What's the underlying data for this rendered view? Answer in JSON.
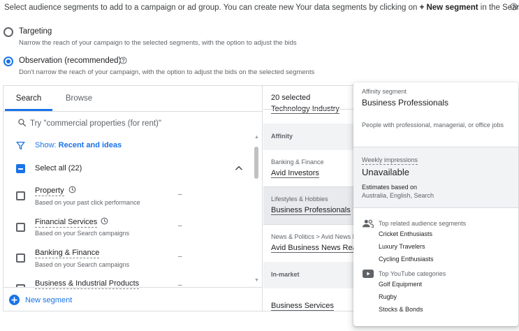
{
  "intro": {
    "text_before": "Select audience segments to add to a campaign or ad group. You can create new Your data segments by clicking on ",
    "bold": "+ New segment",
    "text_after": " in the Search tab."
  },
  "targeting_options": [
    {
      "title": "Targeting",
      "description": "Narrow the reach of your campaign to the selected segments, with the option to adjust the bids",
      "selected": false
    },
    {
      "title": "Observation (recommended)",
      "description": "Don't narrow the reach of your campaign, with the option to adjust the bids on the selected segments",
      "selected": true
    }
  ],
  "tabs": [
    {
      "label": "Search",
      "active": true
    },
    {
      "label": "Browse",
      "active": false
    }
  ],
  "search": {
    "placeholder": "Try \"commercial properties (for rent)\""
  },
  "filter": {
    "prefix": "Show: ",
    "value": "Recent and ideas"
  },
  "select_all": {
    "label": "Select all (22)"
  },
  "segments": [
    {
      "name": "Property",
      "description": "Based on your past click performance",
      "value": "–",
      "has_clock": true
    },
    {
      "name": "Financial Services",
      "description": "Based on your Search campaigns",
      "value": "–",
      "has_clock": true
    },
    {
      "name": "Banking & Finance",
      "description": "Based on your Search campaigns",
      "value": "–",
      "has_clock": false
    },
    {
      "name": "Business & Industrial Products",
      "value": "–",
      "has_clock": false
    }
  ],
  "new_segment": {
    "label": "New segment"
  },
  "selected_panel": {
    "count_label": "20 selected",
    "cut_item": "Technology Industry",
    "groups": {
      "affinity": "Affinity",
      "in_market": "In-market"
    },
    "items": [
      {
        "category": "Banking & Finance",
        "name": "Avid Investors"
      },
      {
        "category": "Lifestyles & Hobbies",
        "name": "Business Professionals"
      },
      {
        "category": "News & Politics > Avid News Readers",
        "name": "Avid Business News Readers"
      },
      {
        "category": "",
        "name": "Business Services"
      }
    ]
  },
  "tooltip": {
    "type_label": "Affinity segment",
    "title": "Business Professionals",
    "description": "People with professional, managerial, or office jobs",
    "impressions_label": "Weekly impressions",
    "impressions_value": "Unavailable",
    "estimates_label": "Estimates based on",
    "estimates_value": "Australia, English, Search",
    "related_title": "Top related audience segments",
    "related_segments": [
      "Cricket Enthusiasts",
      "Luxury Travelers",
      "Cycling Enthusiasts"
    ],
    "youtube_title": "Top YouTube categories",
    "youtube_categories": [
      "Golf Equipment",
      "Rugby",
      "Stocks & Bonds"
    ]
  },
  "colors": {
    "accent": "#1a73e8",
    "text": "#202124",
    "secondary_text": "#5f6368",
    "divider": "#dadce0"
  }
}
